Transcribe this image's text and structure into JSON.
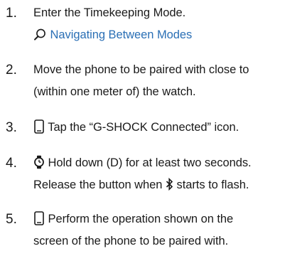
{
  "steps": [
    {
      "number": "1.",
      "text": "Enter the Timekeeping Mode.",
      "link_icon": "search-icon",
      "link_text": "Navigating Between Modes"
    },
    {
      "number": "2.",
      "line1": "Move the phone to be paired with close to",
      "line2": "(within one meter of) the watch."
    },
    {
      "number": "3.",
      "icon": "phone-icon",
      "text": "Tap the “G-SHOCK Connected” icon."
    },
    {
      "number": "4.",
      "icon": "watch-icon",
      "line1": "Hold down (D) for at least two seconds.",
      "line2_before": "Release the button when",
      "line2_icon": "bluetooth-icon",
      "line2_after": "starts to flash."
    },
    {
      "number": "5.",
      "icon": "phone-icon",
      "line1": "Perform the operation shown on the",
      "line2": "screen of the phone to be paired with."
    }
  ],
  "colors": {
    "text": "#1a1a1a",
    "link": "#2a6fb5"
  }
}
